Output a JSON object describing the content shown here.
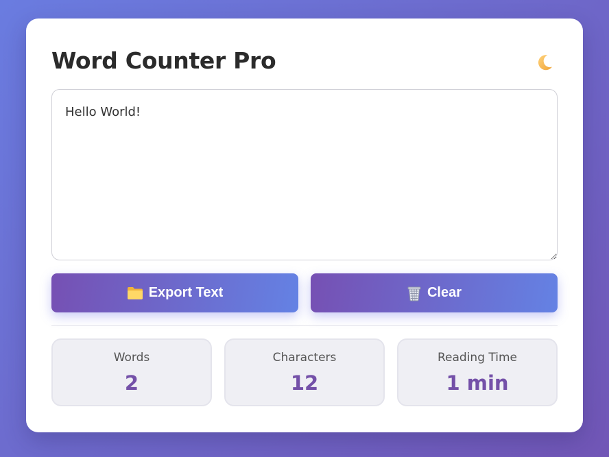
{
  "app": {
    "title": "Word Counter Pro",
    "theme_toggle_icon": "moon-icon"
  },
  "editor": {
    "value": "Hello World!",
    "placeholder": ""
  },
  "actions": {
    "export": {
      "label": "Export Text",
      "icon": "folder-icon"
    },
    "clear": {
      "label": "Clear",
      "icon": "wastebasket-icon"
    }
  },
  "stats": [
    {
      "label": "Words",
      "value": "2"
    },
    {
      "label": "Characters",
      "value": "12"
    },
    {
      "label": "Reading Time",
      "value": "1 min"
    }
  ],
  "colors": {
    "background_start": "#6a7ce0",
    "background_end": "#7156b6",
    "button_start": "#7650b3",
    "button_end": "#6482e4",
    "stat_value": "#7450a8"
  }
}
